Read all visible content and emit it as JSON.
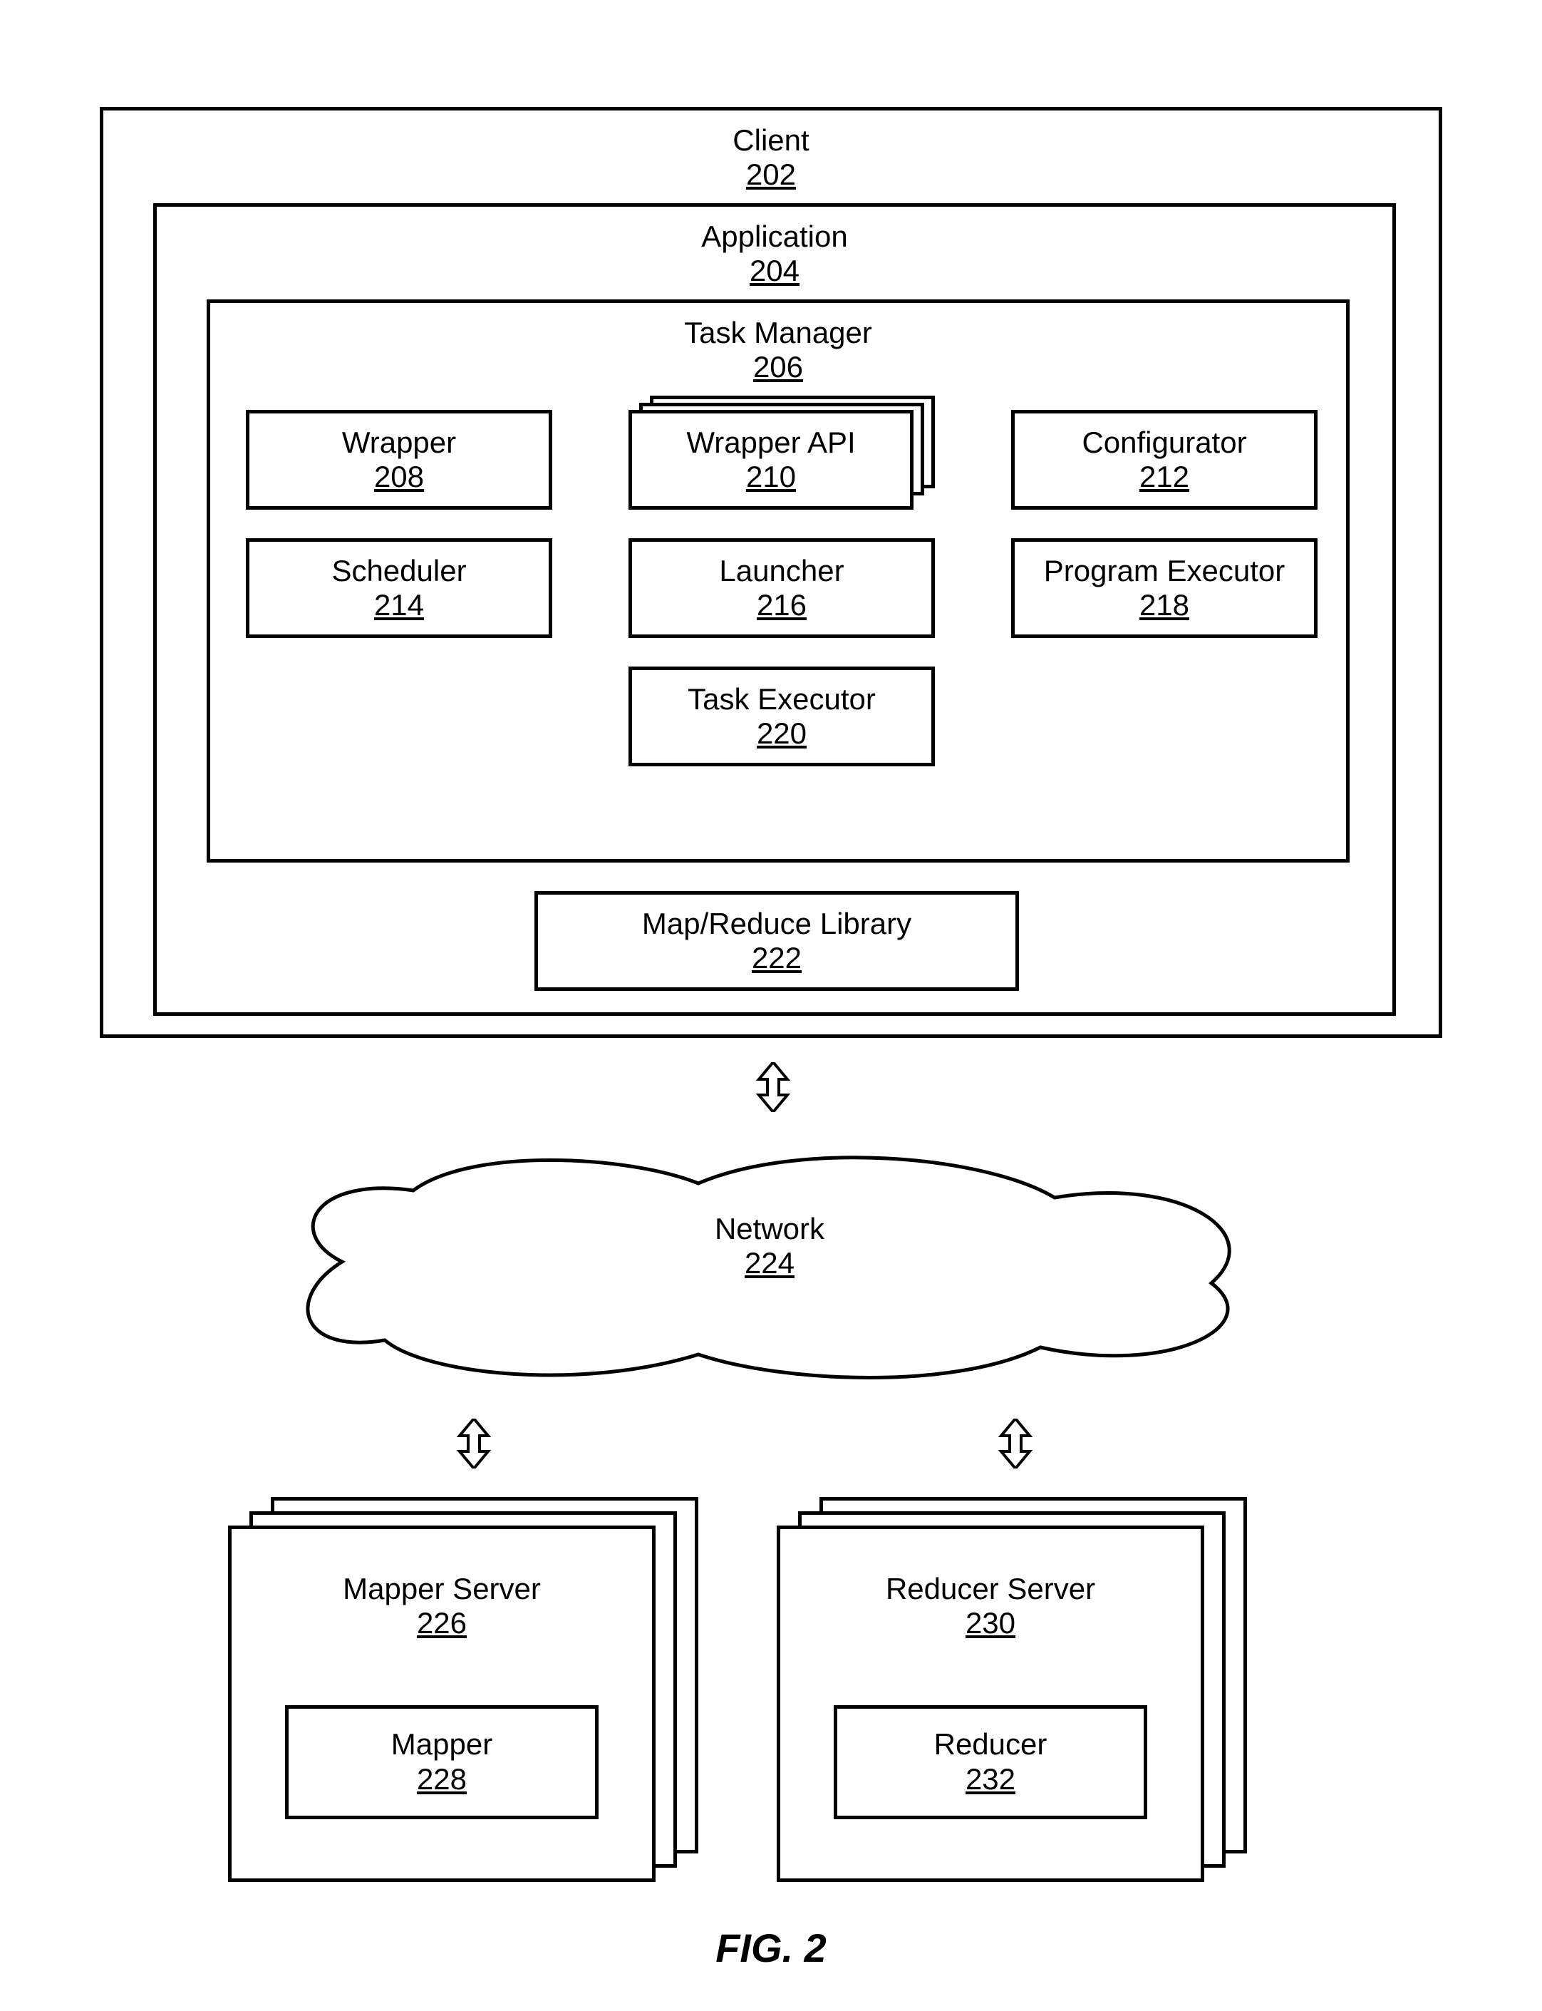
{
  "client": {
    "title": "Client",
    "num": "202"
  },
  "application": {
    "title": "Application",
    "num": "204"
  },
  "taskmgr": {
    "title": "Task Manager",
    "num": "206"
  },
  "components": {
    "wrapper": {
      "title": "Wrapper",
      "num": "208"
    },
    "wrapperapi": {
      "title": "Wrapper API",
      "num": "210"
    },
    "config": {
      "title": "Configurator",
      "num": "212"
    },
    "scheduler": {
      "title": "Scheduler",
      "num": "214"
    },
    "launcher": {
      "title": "Launcher",
      "num": "216"
    },
    "progexec": {
      "title": "Program Executor",
      "num": "218"
    },
    "taskexec": {
      "title": "Task Executor",
      "num": "220"
    }
  },
  "maplib": {
    "title": "Map/Reduce Library",
    "num": "222"
  },
  "network": {
    "title": "Network",
    "num": "224"
  },
  "mapper_server": {
    "title": "Mapper Server",
    "num": "226"
  },
  "mapper": {
    "title": "Mapper",
    "num": "228"
  },
  "reducer_server": {
    "title": "Reducer Server",
    "num": "230"
  },
  "reducer": {
    "title": "Reducer",
    "num": "232"
  },
  "figure": "FIG. 2"
}
